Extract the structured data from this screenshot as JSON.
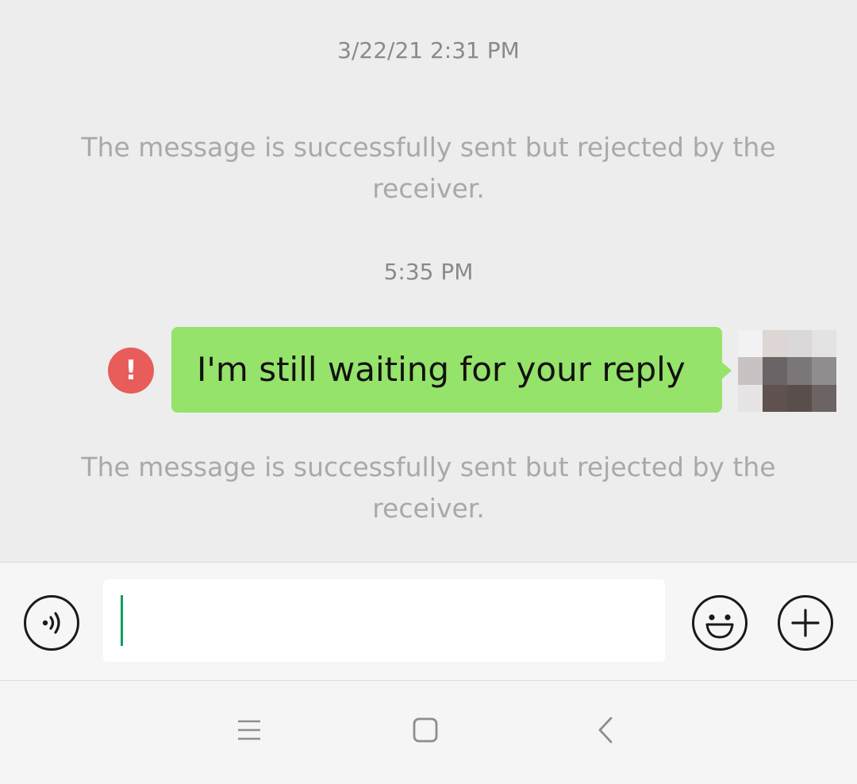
{
  "chat": {
    "timestamp_1": "3/22/21 2:31 PM",
    "notice_1": "The message is successfully sent but rejected by the receiver.",
    "timestamp_2": "5:35 PM",
    "message": {
      "text": "I'm still waiting for your reply",
      "status": "failed",
      "error_symbol": "!"
    },
    "notice_2": "The message is successfully sent but rejected by the receiver."
  },
  "input_bar": {
    "text_value": "",
    "voice_icon": "voice-icon",
    "emoji_icon": "smiley-icon",
    "plus_icon": "plus-icon"
  },
  "navigation": {
    "menu_icon": "menu-icon",
    "home_icon": "home-icon",
    "back_icon": "back-icon"
  },
  "colors": {
    "background": "#ededed",
    "bubble": "#95e36a",
    "error": "#e85d5a",
    "caret": "#07a35a"
  }
}
